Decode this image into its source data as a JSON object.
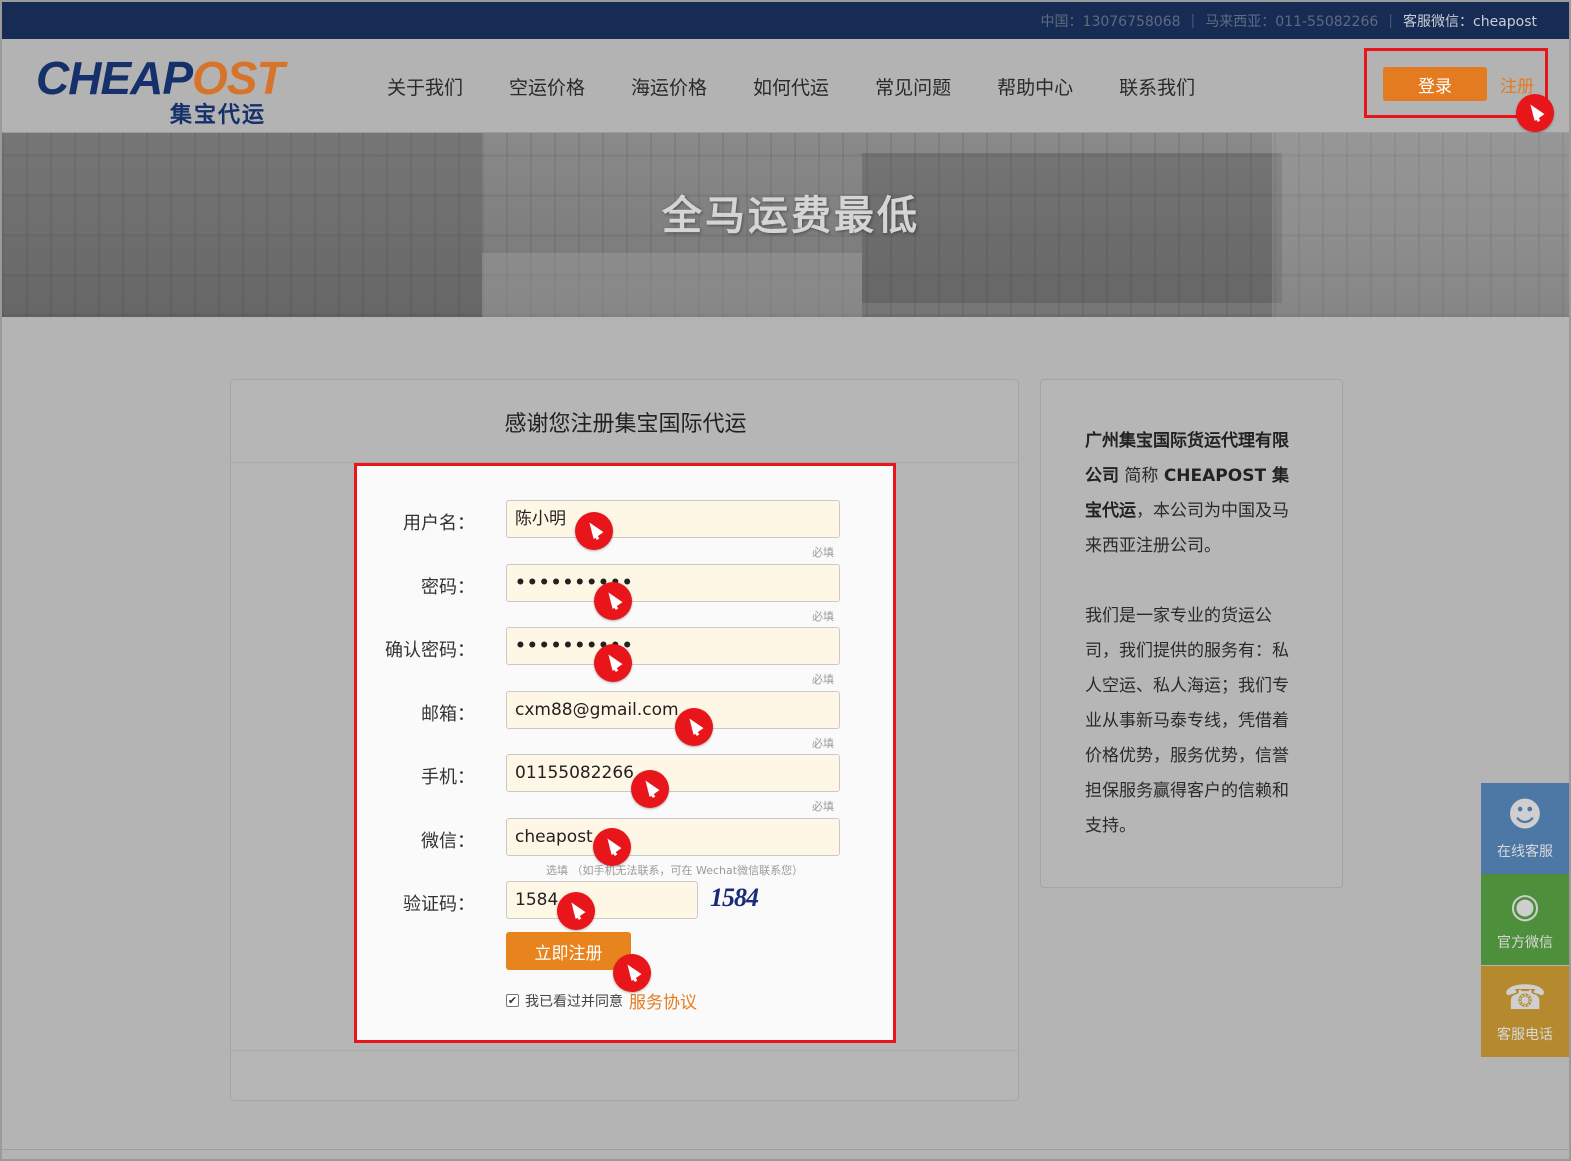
{
  "topbar": {
    "china_phone": "中国：13076758068",
    "malaysia_phone": "马来西亚：011-55082266",
    "wechat": "客服微信：cheapost",
    "separator": "|"
  },
  "header": {
    "logo_text_a": "CHEAP",
    "logo_text_b": "OST",
    "logo_sub": "集宝代运",
    "nav": [
      "关于我们",
      "空运价格",
      "海运价格",
      "如何代运",
      "常见问题",
      "帮助中心",
      "联系我们"
    ],
    "login_label": "登录",
    "register_label": "注册"
  },
  "banner": {
    "slogan": "全马运费最低"
  },
  "form": {
    "title": "感谢您注册集宝国际代运",
    "fields": [
      {
        "label": "用户名：",
        "value": "陈小明",
        "hint": "必填"
      },
      {
        "label": "密码：",
        "value": "••••••••••",
        "hint": "必填"
      },
      {
        "label": "确认密码：",
        "value": "••••••••••",
        "hint": "必填"
      },
      {
        "label": "邮箱：",
        "value": "cxm88@gmail.com",
        "hint": "必填"
      },
      {
        "label": "手机：",
        "value": "01155082266",
        "hint": "必填"
      },
      {
        "label": "微信：",
        "value": "cheapost",
        "hint": "选填 （如手机无法联系，可在 Wechat微信联系您）"
      },
      {
        "label": "验证码：",
        "value": "1584",
        "hint": ""
      }
    ],
    "captcha_text": "1584",
    "submit_label": "立即注册",
    "agree_text": "我已看过并同意",
    "agree_checked": "✔",
    "tos_label": "服务协议"
  },
  "info": {
    "company_bold": "广州集宝国际货运代理有限公司",
    "abbr_text": " 简称 ",
    "abbr_bold": "CHEAPOST 集宝代运",
    "reg_text": "，本公司为中国及马来西亚注册公司。",
    "intro": "我们是一家专业的货运公司，我们提供的服务有：私人空运、私人海运；我们专业从事新马泰专线，凭借着价格优势，服务优势，信誉担保服务赢得客户的信赖和支持。"
  },
  "float": [
    {
      "label": "在线客服",
      "icon": "user-support-icon",
      "color": "#4d77a4"
    },
    {
      "label": "官方微信",
      "icon": "wechat-icon",
      "color": "#4d8f3b"
    },
    {
      "label": "客服电话",
      "icon": "phone-icon",
      "color": "#b58a2e"
    }
  ],
  "colors": {
    "accent": "#e47b20",
    "highlight": "#e8151b",
    "topbar": "#172c55"
  }
}
